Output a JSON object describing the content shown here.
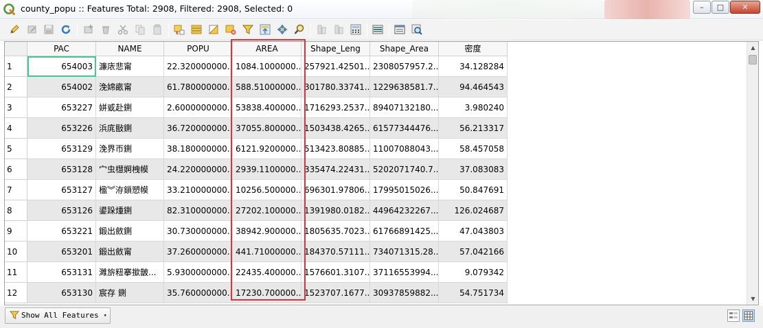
{
  "window": {
    "title": "county_popu :: Features Total: 2908, Filtered: 2908, Selected: 0",
    "minimize_glyph": "–",
    "maximize_glyph": "□",
    "close_glyph": "✕"
  },
  "colors": {
    "highlight_border": "#e03038",
    "focus_cell": "#3ccb95",
    "alt_row": "#e8e8e8"
  },
  "toolbar": {
    "icons": [
      "toggle-editing-pencil-icon",
      "multi-edit-icon",
      "save-edits-icon",
      "reload-icon",
      "add-feature-icon",
      "delete-feature-icon",
      "cut-icon",
      "copy-icon",
      "paste-icon",
      "select-by-expression-icon",
      "select-all-icon",
      "invert-selection-icon",
      "deselect-all-icon",
      "filter-icon",
      "move-selection-to-top-icon",
      "pan-to-selected-icon",
      "zoom-to-selected-icon",
      "new-field-icon",
      "delete-field-icon",
      "field-calculator-icon",
      "conditional-formatting-icon",
      "dock-table-icon",
      "actions-icon"
    ]
  },
  "table": {
    "columns": [
      "PAC",
      "NAME",
      "POPU",
      "AREA",
      "Shape_Leng",
      "Shape_Area",
      "密度"
    ],
    "rows": [
      {
        "n": "1",
        "pac": "654003",
        "name": "濂庡悲甯",
        "popu": "22.320000000...",
        "area": "1084.1000000...",
        "leng": "257921.42501...",
        "sarea": "2308057957.2...",
        "density": "34.128284"
      },
      {
        "n": "2",
        "pac": "654002",
        "name": "浼婂畞甯",
        "popu": "61.780000000...",
        "area": "588.51000000...",
        "leng": "301780.33741...",
        "sarea": "1229638581.7...",
        "density": "94.464543"
      },
      {
        "n": "3",
        "pac": "653227",
        "name": "姘戜赴鍘",
        "popu": "2.6000000000...",
        "area": "53838.400000...",
        "leng": "1716293.2537...",
        "sarea": "89407132180....",
        "density": "3.980240"
      },
      {
        "n": "4",
        "pac": "653226",
        "name": "浜庣敯鍘",
        "popu": "36.720000000...",
        "area": "37055.800000...",
        "leng": "1503438.4265...",
        "sarea": "61577344476....",
        "density": "56.213317"
      },
      {
        "n": "5",
        "pac": "653129",
        "name": "浼界帀鍘",
        "popu": "38.180000000...",
        "area": "6121.9200000...",
        "leng": "513423.80885...",
        "sarea": "11007088043....",
        "density": "58.457058"
      },
      {
        "n": "6",
        "pac": "653128",
        "name": "宀虫櫘婀栧幙",
        "popu": "24.220000000...",
        "area": "2939.1100000...",
        "leng": "335474.22431...",
        "sarea": "5202071740.7...",
        "density": "37.083083"
      },
      {
        "n": "7",
        "pac": "653127",
        "name": "楹︾洊鎻愬幙",
        "popu": "33.210000000...",
        "area": "10256.500000...",
        "leng": "696301.97806...",
        "sarea": "17995015026....",
        "density": "50.847691"
      },
      {
        "n": "8",
        "pac": "653126",
        "name": "鍙跺煄鍘",
        "popu": "82.310000000...",
        "area": "27202.100000...",
        "leng": "1391980.0182...",
        "sarea": "44964232267....",
        "density": "126.024687"
      },
      {
        "n": "9",
        "pac": "653221",
        "name": "鍛出斂鍘",
        "popu": "30.730000000...",
        "area": "38942.900000...",
        "leng": "1805635.7023...",
        "sarea": "61766891425....",
        "density": "47.043803"
      },
      {
        "n": "10",
        "pac": "653201",
        "name": "鍛出斂甯",
        "popu": "37.260000000...",
        "area": "441.71000000...",
        "leng": "184370.57111...",
        "sarea": "734071315.28...",
        "density": "57.042166"
      },
      {
        "n": "11",
        "pac": "653131",
        "name": "濉旂粈搴撳皵...",
        "popu": "5.9300000000...",
        "area": "22435.400000...",
        "leng": "1576601.3107...",
        "sarea": "37116553994....",
        "density": "9.079342"
      },
      {
        "n": "12",
        "pac": "653130",
        "name": "宸存   鍘",
        "popu": "35.760000000...",
        "area": "17230.700000...",
        "leng": "1523707.1677...",
        "sarea": "30937859882....",
        "density": "54.751734"
      }
    ]
  },
  "status": {
    "show_features_label": "Show All Features",
    "caret": "▾"
  }
}
